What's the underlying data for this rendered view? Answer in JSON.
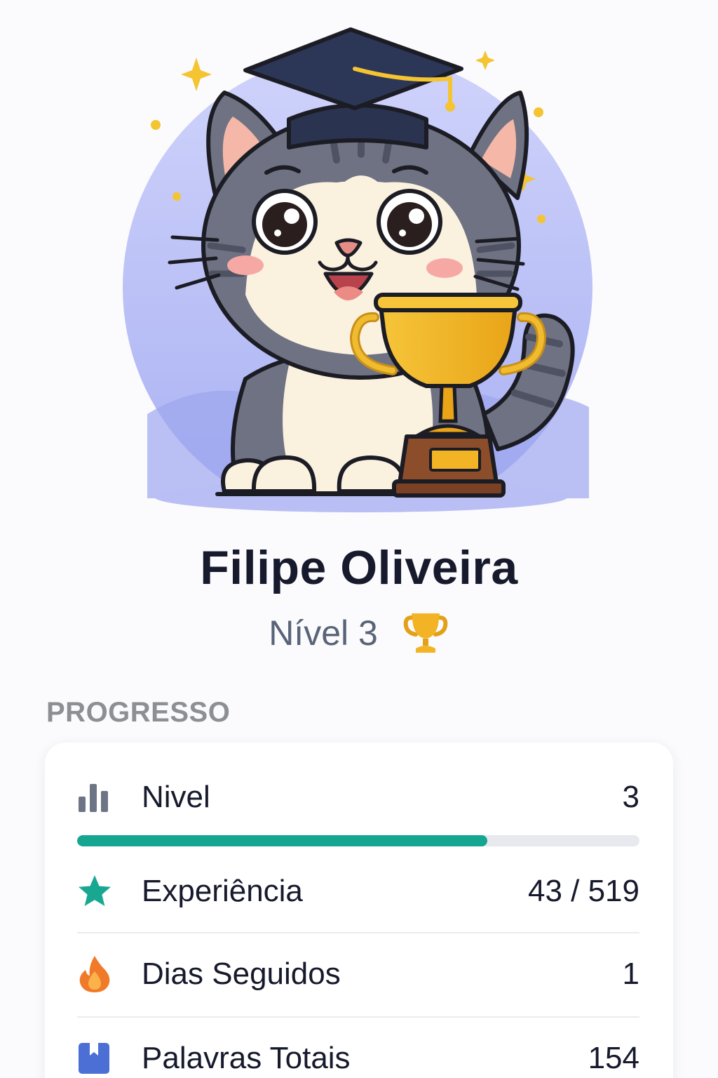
{
  "profile": {
    "name": "Filipe Oliveira",
    "level_label": "Nível 3",
    "avatar_icon": "cat-graduate-trophy-illustration",
    "level_icon": "trophy-icon"
  },
  "progress": {
    "section_title": "PROGRESSO",
    "level_progress_fraction": 0.73,
    "rows": [
      {
        "label": "Nivel",
        "value": "3",
        "icon": "bar-chart-icon"
      },
      {
        "label": "Experiência",
        "value": "43 / 519",
        "icon": "star-icon"
      },
      {
        "label": "Dias Seguidos",
        "value": "1",
        "icon": "flame-icon"
      },
      {
        "label": "Palavras Totais",
        "value": "154",
        "icon": "bookmark-icon"
      }
    ]
  },
  "colors": {
    "accent": "#14a690",
    "star": "#18a892",
    "flame": "#f07a2a",
    "bookmark": "#4c6fd6",
    "bars": "#6d7486",
    "trophy_gold": "#f2b325"
  }
}
